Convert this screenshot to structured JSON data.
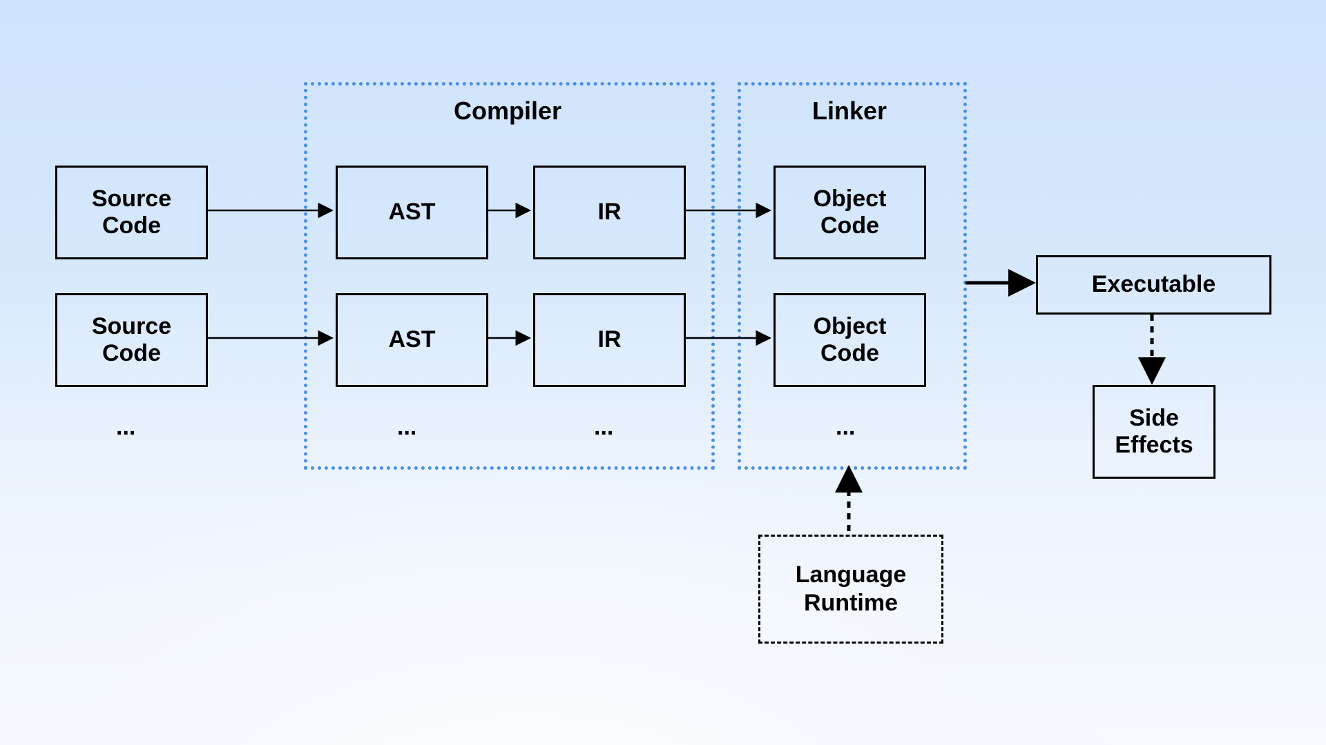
{
  "labels": {
    "source_code": "Source\nCode",
    "ast": "AST",
    "ir": "IR",
    "object_code": "Object\nCode",
    "compiler": "Compiler",
    "linker": "Linker",
    "executable": "Executable",
    "side_effects": "Side\nEffects",
    "language_runtime": "Language\nRuntime",
    "ellipsis": "..."
  }
}
